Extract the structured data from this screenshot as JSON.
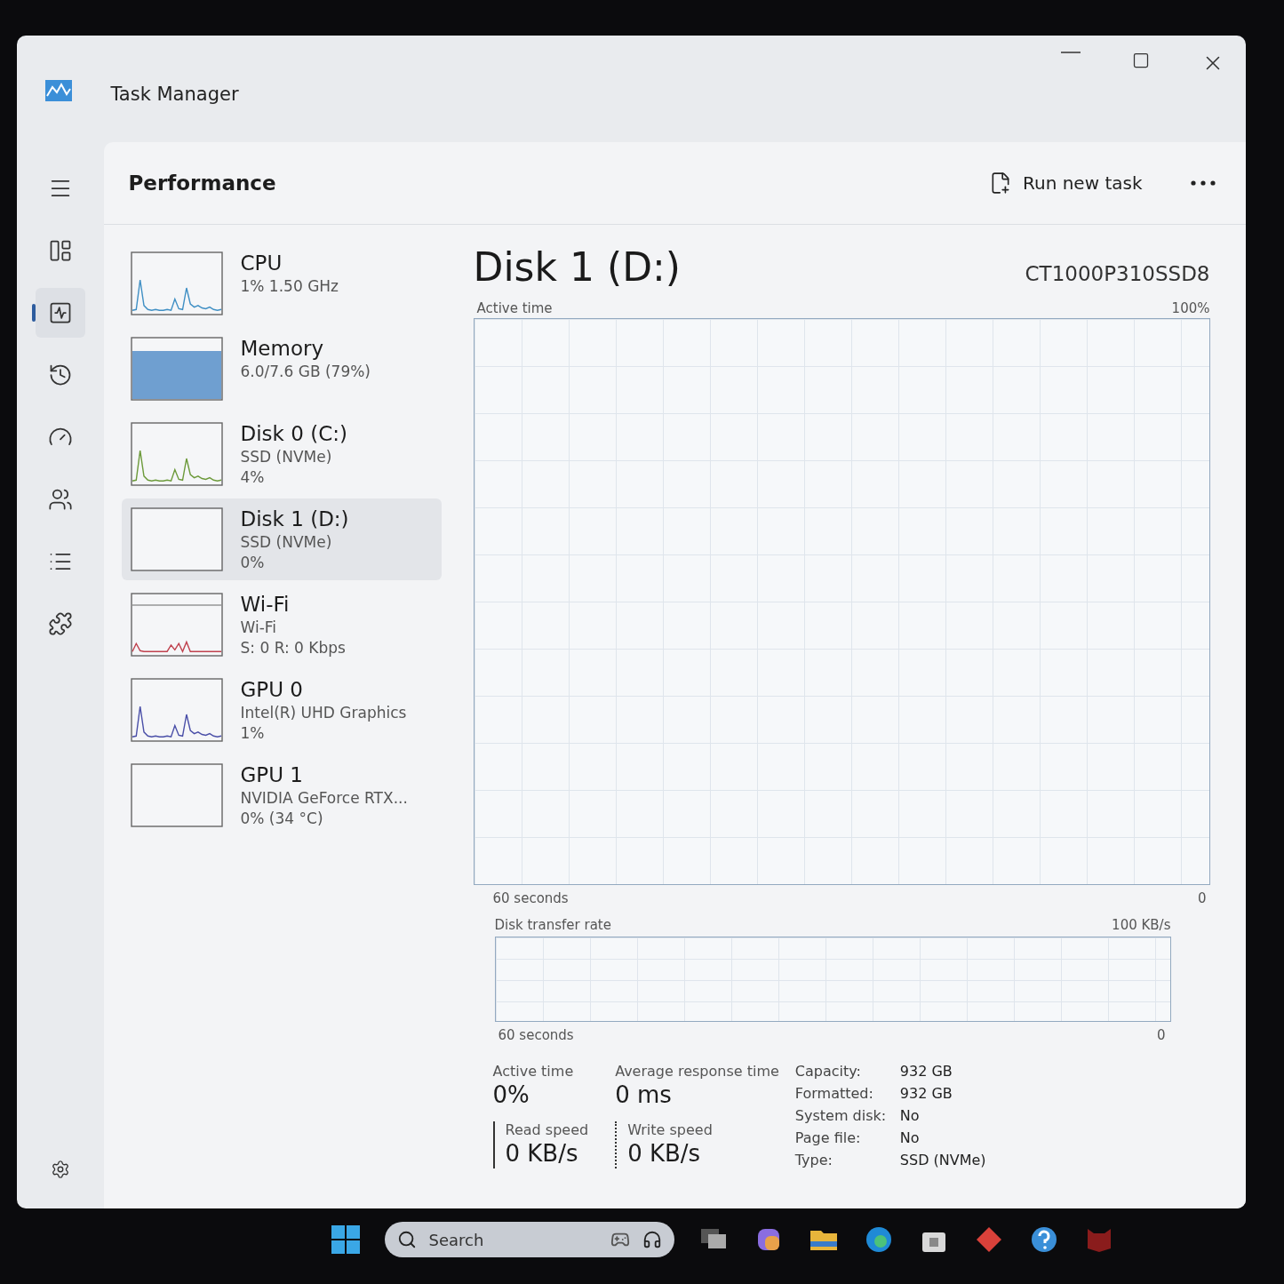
{
  "window": {
    "title": "Task Manager"
  },
  "nav": [
    {
      "kind": "menu",
      "selected": false
    },
    {
      "kind": "processes",
      "selected": false
    },
    {
      "kind": "performance",
      "selected": true
    },
    {
      "kind": "history",
      "selected": false
    },
    {
      "kind": "startup",
      "selected": false
    },
    {
      "kind": "users",
      "selected": false
    },
    {
      "kind": "details",
      "selected": false
    },
    {
      "kind": "services",
      "selected": false
    },
    {
      "kind": "settings",
      "selected": false
    }
  ],
  "header": {
    "title": "Performance",
    "run_new_task": "Run new task"
  },
  "devices": [
    {
      "name": "CPU",
      "lines": [
        "1%  1.50 GHz"
      ],
      "kind": "line",
      "color": "#3f8fc4",
      "selected": false
    },
    {
      "name": "Memory",
      "lines": [
        "6.0/7.6 GB (79%)"
      ],
      "kind": "area",
      "color": "#6f9fd0",
      "selected": false
    },
    {
      "name": "Disk 0 (C:)",
      "lines": [
        "SSD (NVMe)",
        "4%"
      ],
      "kind": "line",
      "color": "#6c9a3a",
      "selected": false
    },
    {
      "name": "Disk 1 (D:)",
      "lines": [
        "SSD (NVMe)",
        "0%"
      ],
      "kind": "empty",
      "selected": true
    },
    {
      "name": "Wi-Fi",
      "lines": [
        "Wi-Fi",
        "S: 0 R: 0 Kbps"
      ],
      "kind": "network",
      "color": "#c0424e",
      "selected": false
    },
    {
      "name": "GPU 0",
      "lines": [
        "Intel(R) UHD Graphics",
        "1%"
      ],
      "kind": "line",
      "color": "#4a4fa8",
      "selected": false
    },
    {
      "name": "GPU 1",
      "lines": [
        "NVIDIA GeForce RTX...",
        "0% (34 °C)"
      ],
      "kind": "empty",
      "selected": false
    }
  ],
  "detail": {
    "title": "Disk 1 (D:)",
    "model": "CT1000P310SSD8",
    "active_graph": {
      "label": "Active time",
      "max": "100%",
      "time": "60 seconds",
      "min": "0"
    },
    "transfer_graph": {
      "label": "Disk transfer rate",
      "max": "100 KB/s",
      "time": "60 seconds",
      "min": "0"
    },
    "stats": [
      {
        "label": "Active time",
        "value": "0%",
        "kind": "plain"
      },
      {
        "label": "Average response time",
        "value": "0 ms",
        "kind": "plain"
      },
      {
        "label": "Read speed",
        "value": "0 KB/s",
        "kind": "solid"
      },
      {
        "label": "Write speed",
        "value": "0 KB/s",
        "kind": "dotted"
      }
    ],
    "properties": [
      {
        "label": "Capacity:",
        "value": "932 GB"
      },
      {
        "label": "Formatted:",
        "value": "932 GB"
      },
      {
        "label": "System disk:",
        "value": "No"
      },
      {
        "label": "Page file:",
        "value": "No"
      },
      {
        "label": "Type:",
        "value": "SSD (NVMe)"
      }
    ]
  },
  "taskbar": {
    "search_placeholder": "Search"
  }
}
